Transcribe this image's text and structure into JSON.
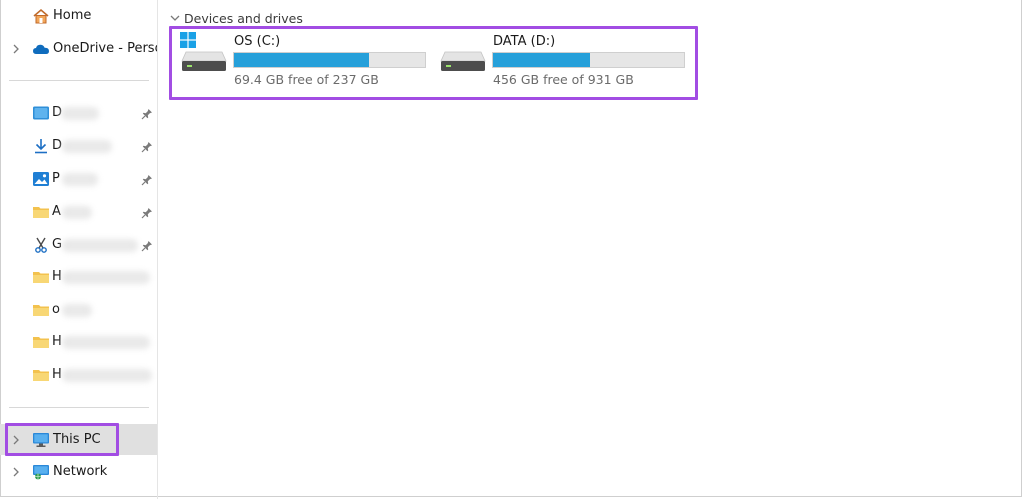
{
  "sidebar": {
    "home": "Home",
    "onedrive": "OneDrive - Person",
    "quick_access": [
      {
        "label": "D",
        "icon": "desktop-icon",
        "pinned": true
      },
      {
        "label": "D",
        "icon": "download-icon",
        "pinned": true
      },
      {
        "label": "P",
        "icon": "pictures-icon",
        "pinned": true
      },
      {
        "label": "A",
        "icon": "folder-icon",
        "pinned": true
      },
      {
        "label": "G",
        "icon": "scissors-icon",
        "pinned": true
      },
      {
        "label": "H",
        "icon": "folder-icon",
        "pinned": false
      },
      {
        "label": "o",
        "icon": "folder-icon",
        "pinned": false
      },
      {
        "label": "H",
        "icon": "folder-icon",
        "pinned": false
      },
      {
        "label": "H",
        "icon": "folder-icon",
        "pinned": false
      }
    ],
    "this_pc": "This PC",
    "network": "Network"
  },
  "main": {
    "section_title": "Devices and drives",
    "drives": [
      {
        "name": "OS (C:)",
        "free_text": "69.4 GB free of 237 GB",
        "used_fraction": 0.707,
        "system": true
      },
      {
        "name": "DATA (D:)",
        "free_text": "456 GB free of 931 GB",
        "used_fraction": 0.51,
        "system": false
      }
    ]
  },
  "colors": {
    "highlight": "#a24de3",
    "usage_bar": "#26a0da",
    "onedrive": "#0f6cbd",
    "folder": "#f3c24e"
  }
}
